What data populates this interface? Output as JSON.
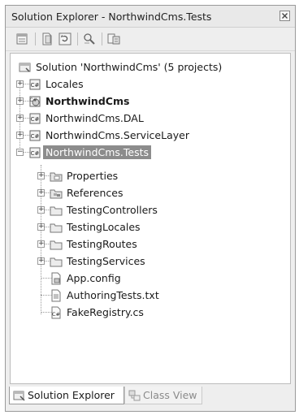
{
  "window": {
    "title": "Solution Explorer - NorthwindCms.Tests",
    "close_glyph": "⊠"
  },
  "toolbar": {
    "buttons": [
      "properties-icon",
      "show-all-files-icon",
      "refresh-icon",
      "view-code-icon",
      "view-designer-icon"
    ]
  },
  "tree": {
    "solution": {
      "label": "Solution 'NorthwindCms' (5 projects)"
    },
    "items": [
      {
        "label": "Locales",
        "type": "project",
        "expander": "+"
      },
      {
        "label": "NorthwindCms",
        "type": "project-web",
        "expander": "+",
        "bold": true
      },
      {
        "label": "NorthwindCms.DAL",
        "type": "project",
        "expander": "+"
      },
      {
        "label": "NorthwindCms.ServiceLayer",
        "type": "project",
        "expander": "+"
      },
      {
        "label": "NorthwindCms.Tests",
        "type": "project",
        "expander": "−",
        "selected": true
      }
    ],
    "children": [
      {
        "label": "Properties",
        "type": "properties-folder",
        "expander": "+"
      },
      {
        "label": "References",
        "type": "references-folder",
        "expander": "+"
      },
      {
        "label": "TestingControllers",
        "type": "folder",
        "expander": "+"
      },
      {
        "label": "TestingLocales",
        "type": "folder",
        "expander": "+"
      },
      {
        "label": "TestingRoutes",
        "type": "folder",
        "expander": "+"
      },
      {
        "label": "TestingServices",
        "type": "folder",
        "expander": "+"
      },
      {
        "label": "App.config",
        "type": "config-file"
      },
      {
        "label": "AuthoringTests.txt",
        "type": "text-file"
      },
      {
        "label": "FakeRegistry.cs",
        "type": "cs-file"
      }
    ]
  },
  "tabs": [
    {
      "label": "Solution Explorer",
      "active": true
    },
    {
      "label": "Class View",
      "active": false
    }
  ]
}
